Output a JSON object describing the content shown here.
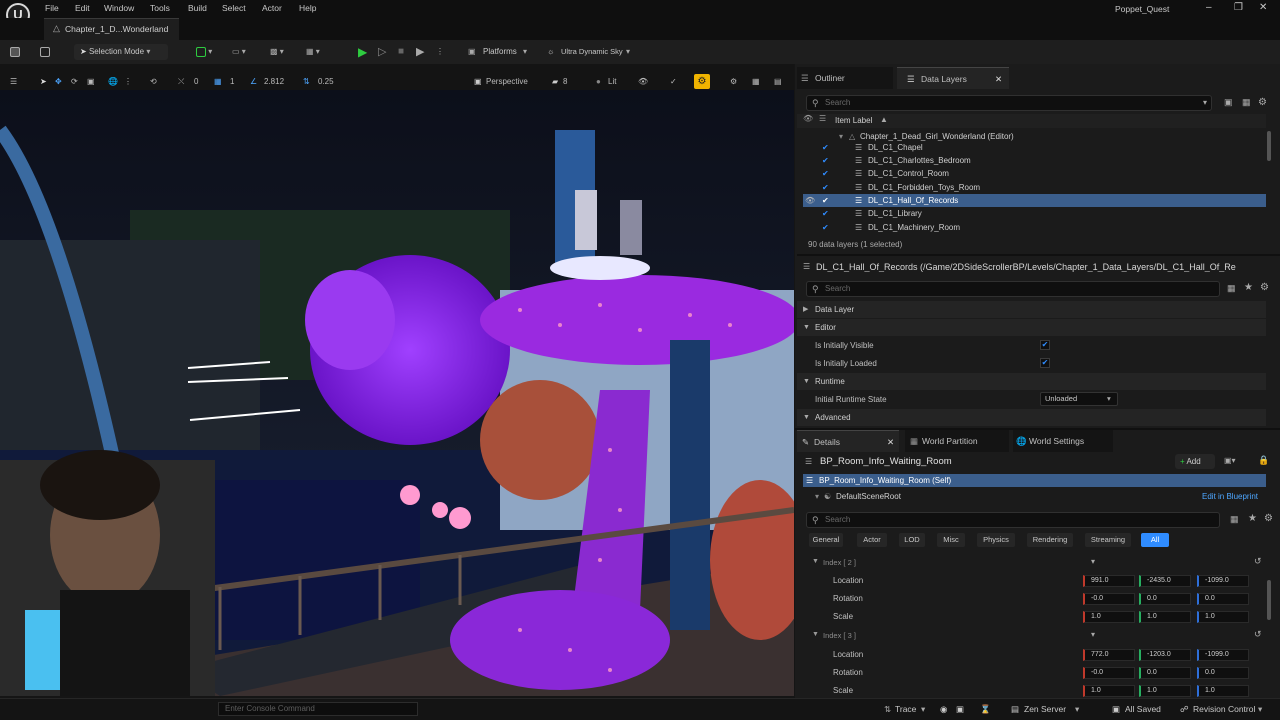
{
  "menu": {
    "items": [
      "File",
      "Edit",
      "Window",
      "Tools",
      "Build",
      "Select",
      "Actor",
      "Help"
    ],
    "project_name": "Poppet_Quest",
    "map_tab": "Chapter_1_D...Wonderland"
  },
  "toolbar": {
    "mode": "Selection Mode",
    "platforms": "Platforms",
    "sky": "Ultra Dynamic Sky"
  },
  "viewport_toolbar": {
    "rotate_val": "0",
    "grid_val": "1",
    "scale_val": "2.812",
    "snap_val": "0.25",
    "perspective": "Perspective",
    "speed": "8",
    "lit": "Lit"
  },
  "outliner": {
    "tab_outliner": "Outliner",
    "tab_data_layers": "Data Layers",
    "search_placeholder": "Search",
    "column_label": "Item Label",
    "root": "Chapter_1_Dead_Girl_Wonderland (Editor)",
    "rows": [
      "DL_C1_Chapel",
      "DL_C1_Charlottes_Bedroom",
      "DL_C1_Control_Room",
      "DL_C1_Forbidden_Toys_Room",
      "DL_C1_Hall_Of_Records",
      "DL_C1_Library",
      "DL_C1_Machinery_Room"
    ],
    "count": "90 data layers (1 selected)"
  },
  "data_layer_details": {
    "path": "DL_C1_Hall_Of_Records (/Game/2DSideScrollerBP/Levels/Chapter_1_Data_Layers/DL_C1_Hall_Of_Re",
    "search_placeholder": "Search",
    "sec_data_layer": "Data Layer",
    "sec_editor": "Editor",
    "initially_visible": "Is Initially Visible",
    "initially_loaded": "Is Initially Loaded",
    "sec_runtime": "Runtime",
    "initial_runtime_state": "Initial Runtime State",
    "runtime_state_value": "Unloaded",
    "sec_advanced": "Advanced"
  },
  "details": {
    "tab_details": "Details",
    "tab_world_partition": "World Partition",
    "tab_world_settings": "World Settings",
    "actor_name": "BP_Room_Info_Waiting_Room",
    "add_label": "Add",
    "self_label": "BP_Room_Info_Waiting_Room (Self)",
    "scene_root": "DefaultSceneRoot",
    "edit_in_blueprint": "Edit in Blueprint",
    "search_placeholder": "Search",
    "filters": [
      "General",
      "Actor",
      "LOD",
      "Misc",
      "Physics",
      "Rendering",
      "Streaming",
      "All"
    ],
    "index2_label": "Index [ 2 ]",
    "index3_label": "Index [ 3 ]",
    "location_label": "Location",
    "rotation_label": "Rotation",
    "scale_label": "Scale",
    "index2": {
      "location": [
        "991.0",
        "-2435.0",
        "-1099.0"
      ],
      "rotation": [
        "-0.0",
        "0.0",
        "0.0"
      ],
      "scale": [
        "1.0",
        "1.0",
        "1.0"
      ]
    },
    "index3": {
      "location": [
        "772.0",
        "-1203.0",
        "-1099.0"
      ],
      "rotation": [
        "-0.0",
        "0.0",
        "0.0"
      ],
      "scale": [
        "1.0",
        "1.0",
        "1.0"
      ]
    }
  },
  "statusbar": {
    "console_placeholder": "Enter Console Command",
    "trace": "Trace",
    "zen_server": "Zen Server",
    "all_saved": "All Saved",
    "revision_control": "Revision Control"
  },
  "colors": {
    "accent_blue": "#2f8cff",
    "play_green": "#2ecc40",
    "selection": "#3b5e8c"
  }
}
